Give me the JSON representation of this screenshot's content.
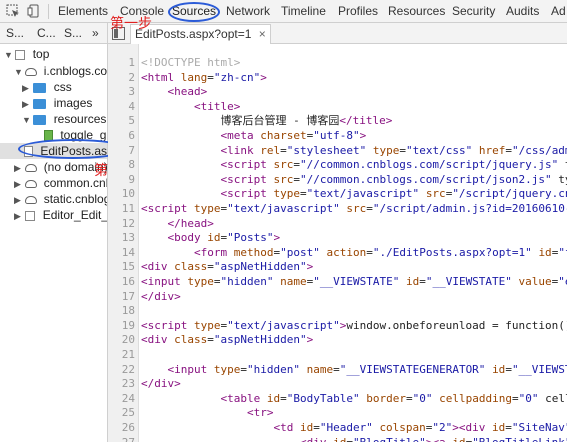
{
  "toolbar": {
    "tabs": [
      "Elements",
      "Console",
      "Sources",
      "Network",
      "Timeline",
      "Profiles",
      "Resources",
      "Security",
      "Audits",
      "Ad"
    ]
  },
  "annotations": {
    "step1": "第一步",
    "step2": "第二步"
  },
  "subbar": {
    "tab1": "S...",
    "tab2": "C...",
    "tab3": "S...",
    "more": "»"
  },
  "file_tab": {
    "label": "EditPosts.aspx?opt=1",
    "close": "×"
  },
  "tree": {
    "items": [
      {
        "label": "top"
      },
      {
        "label": "i.cnblogs.com"
      },
      {
        "label": "css"
      },
      {
        "label": "images"
      },
      {
        "label": "resources"
      },
      {
        "label": "toggle_gr"
      },
      {
        "label": "EditPosts.as"
      },
      {
        "label": "(no domain)"
      },
      {
        "label": "common.cnbl"
      },
      {
        "label": "static.cnblog"
      },
      {
        "label": "Editor_Edit_E"
      }
    ]
  },
  "code": {
    "lines": [
      "<!DOCTYPE html>",
      "<html lang=\"zh-cn\">",
      "    <head>",
      "        <title>",
      "            博客后台管理 - 博客园</title>",
      "            <meta charset=\"utf-8\">",
      "            <link rel=\"stylesheet\" type=\"text/css\" href=\"/css/adm",
      "            <script src=\"//common.cnblogs.com/script/jquery.js\" t",
      "            <script src=\"//common.cnblogs.com/script/json2.js\" ty",
      "            <script type=\"text/javascript\" src=\"/script/jquery.cn",
      "<script type=\"text/javascript\" src=\"/script/admin.js?id=20160610-",
      "    </head>",
      "    <body id=\"Posts\">",
      "        <form method=\"post\" action=\"./EditPosts.aspx?opt=1\" id=\"f",
      "<div class=\"aspNetHidden\">",
      "<input type=\"hidden\" name=\"__VIEWSTATE\" id=\"__VIEWSTATE\" value=\"e",
      "</div>",
      "",
      "<script type=\"text/javascript\">window.onbeforeunload = function()",
      "<div class=\"aspNetHidden\">",
      "",
      "    <input type=\"hidden\" name=\"__VIEWSTATEGENERATOR\" id=\"__VIEWST",
      "</div>",
      "            <table id=\"BodyTable\" border=\"0\" cellpadding=\"0\" cell",
      "                <tr>",
      "                    <td id=\"Header\" colspan=\"2\"><div id=\"SiteNav\"",
      "                        <div id=\"BlogTitle\"><a id=\"BlogTitleLink\""
    ]
  }
}
